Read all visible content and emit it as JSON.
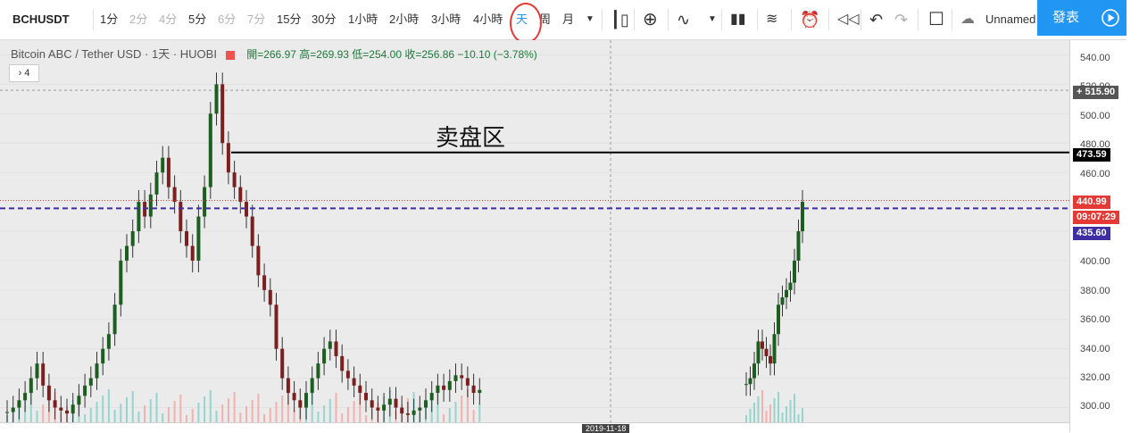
{
  "toolbar": {
    "symbol": "BCHUSDT",
    "intervals": [
      {
        "label": "1分",
        "state": "normal"
      },
      {
        "label": "2分",
        "state": "dim"
      },
      {
        "label": "4分",
        "state": "dim"
      },
      {
        "label": "5分",
        "state": "normal"
      },
      {
        "label": "6分",
        "state": "dim"
      },
      {
        "label": "7分",
        "state": "dim"
      },
      {
        "label": "15分",
        "state": "normal"
      },
      {
        "label": "30分",
        "state": "normal"
      },
      {
        "label": "1小時",
        "state": "normal"
      },
      {
        "label": "2小時",
        "state": "normal"
      },
      {
        "label": "3小時",
        "state": "normal"
      },
      {
        "label": "4小時",
        "state": "normal"
      },
      {
        "label": "天",
        "state": "selected"
      },
      {
        "label": "周",
        "state": "normal"
      },
      {
        "label": "月",
        "state": "normal"
      }
    ],
    "layout_name": "Unnamed",
    "publish_label": "發表",
    "icons": [
      "chevron-down-icon",
      "candle-style-icon",
      "add-indicator-icon",
      "compare-icon",
      "chevron-down-icon",
      "bar-indicator-icon",
      "templates-icon",
      "alert-clock-icon",
      "replay-icon",
      "undo-icon",
      "redo-icon",
      "fullscreen-icon",
      "cloud-icon",
      "play-icon"
    ]
  },
  "legend": {
    "title": "Bitcoin ABC / Tether USD · 1天 · HUOBI",
    "ohlc": "開=266.97  高=269.93  低=254.00  收=256.86  −10.10 (−3.78%)",
    "indicator_collapse": "4"
  },
  "annotation": {
    "text": "卖盘区"
  },
  "axis_ticks": [
    "540.00",
    "520.00",
    "500.00",
    "480.00",
    "460.00",
    "420.00",
    "400.00",
    "380.00",
    "360.00",
    "340.00",
    "320.00",
    "300.00"
  ],
  "price_labels": {
    "crosshair": "515.90",
    "resistance": "473.59",
    "last_price": "440.99",
    "countdown": "09:07:29",
    "dashed_line": "435.60"
  },
  "bottom_label": "2019-11-18",
  "colors": {
    "up": "#26a69a",
    "down": "#ef5350",
    "candle": "#1b5e20",
    "candle_down": "#7b1f1f",
    "accent": "#2196f3",
    "purple": "#3f2da3",
    "red": "#e53935"
  },
  "chart_data": {
    "type": "candlestick",
    "y_unit": "USDT",
    "ylim": [
      290,
      550
    ],
    "closes": [
      297,
      300,
      305,
      310,
      320,
      330,
      315,
      305,
      300,
      298,
      296,
      302,
      308,
      315,
      320,
      330,
      340,
      350,
      370,
      400,
      410,
      420,
      440,
      430,
      445,
      460,
      470,
      450,
      440,
      420,
      410,
      400,
      430,
      450,
      500,
      520,
      480,
      460,
      450,
      440,
      430,
      410,
      390,
      380,
      370,
      340,
      320,
      310,
      305,
      300,
      310,
      320,
      330,
      340,
      345,
      335,
      325,
      320,
      315,
      310,
      305,
      300,
      298,
      302,
      306,
      300,
      296,
      295,
      298,
      300,
      305,
      310,
      315,
      312,
      318,
      322,
      320,
      315,
      310,
      312,
      316,
      320,
      330,
      345,
      340,
      335,
      330,
      350,
      370,
      375,
      380,
      385,
      400,
      420,
      440
    ]
  }
}
